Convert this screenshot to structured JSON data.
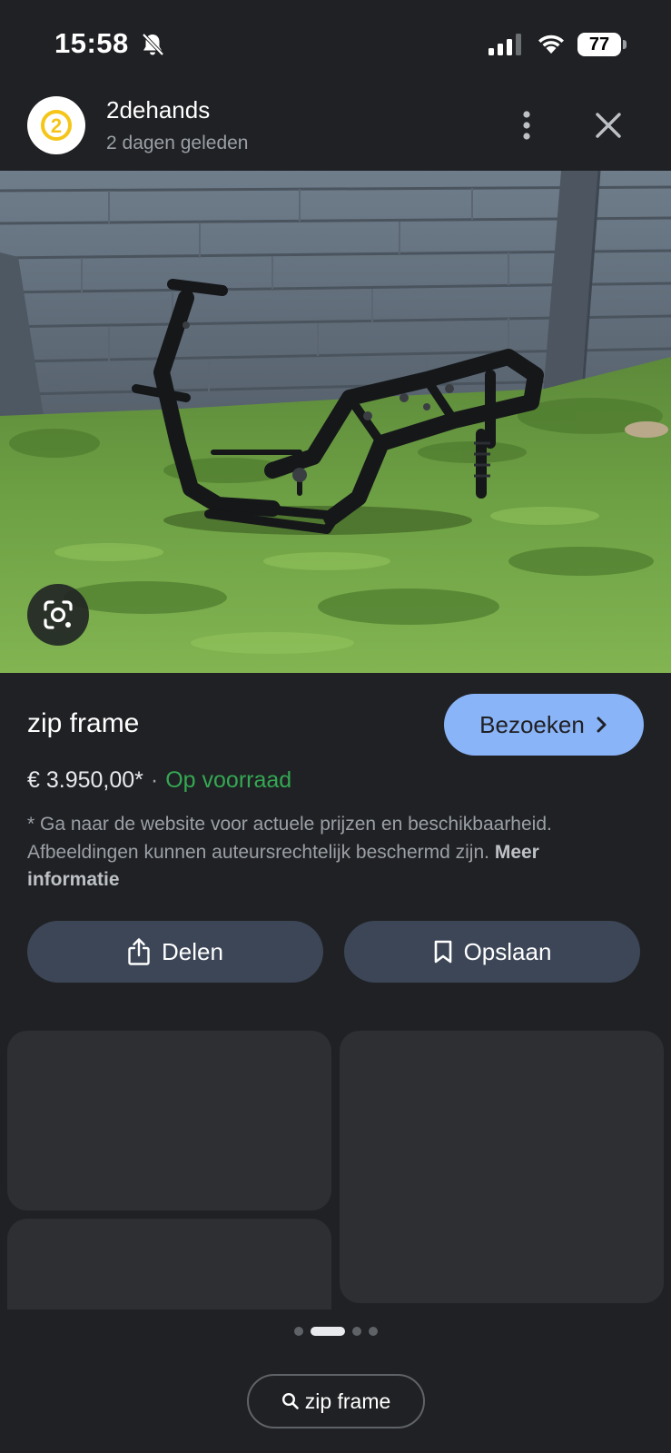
{
  "status_bar": {
    "time": "15:58",
    "battery": "77"
  },
  "header": {
    "site_name": "2dehands",
    "posted": "2 dagen geleden",
    "logo_glyph": "2"
  },
  "product": {
    "title": "zip frame",
    "visit_label": "Bezoeken",
    "price": "€ 3.950,00*",
    "separator": "·",
    "availability": "Op voorraad",
    "disclaimer": "* Ga naar de website voor actuele prijzen en beschikbaarheid. Afbeeldingen kunnen auteursrechtelijk beschermd zijn.",
    "more_info": "Meer informatie"
  },
  "actions": {
    "share_label": "Delen",
    "save_label": "Opslaan"
  },
  "pager": {
    "total_pages": 4,
    "active_index": 1
  },
  "search_chip": {
    "query": "zip frame"
  },
  "colors": {
    "background": "#202124",
    "accent": "#8ab4f8",
    "in_stock": "#34a853",
    "action_button": "#3c4657",
    "logo_ring": "#f5c518"
  },
  "icons": {
    "status": [
      "bell-off-icon",
      "cellular-signal-icon",
      "wifi-icon",
      "battery-icon"
    ],
    "header": [
      "more-vertical-icon",
      "close-icon"
    ],
    "photo": "google-lens-icon",
    "visit": "chevron-right-icon",
    "share": "share-icon",
    "save": "bookmark-icon",
    "search": "search-icon"
  }
}
